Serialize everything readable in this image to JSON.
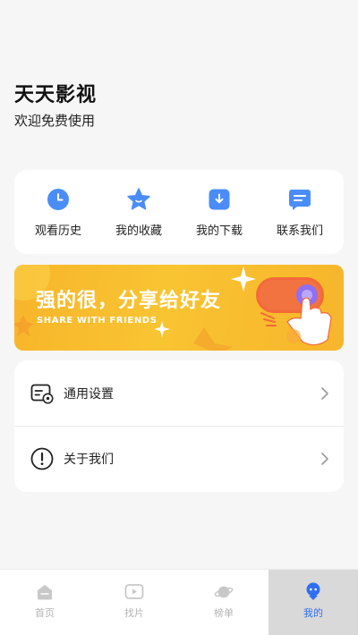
{
  "header": {
    "title": "天天影视",
    "subtitle": "欢迎免费使用"
  },
  "quick_actions": [
    {
      "label": "观看历史",
      "icon": "clock-icon"
    },
    {
      "label": "我的收藏",
      "icon": "star-icon"
    },
    {
      "label": "我的下载",
      "icon": "download-icon"
    },
    {
      "label": "联系我们",
      "icon": "chat-icon"
    }
  ],
  "banner": {
    "title": "强的很，分享给好友",
    "subtitle": "SHARE WITH FRIENDS"
  },
  "settings": [
    {
      "label": "通用设置",
      "icon": "settings-card-icon"
    },
    {
      "label": "关于我们",
      "icon": "info-icon"
    }
  ],
  "tabbar": {
    "active_index": 3,
    "tabs": [
      {
        "label": "首页",
        "icon": "home-icon"
      },
      {
        "label": "找片",
        "icon": "play-icon"
      },
      {
        "label": "榜单",
        "icon": "planet-icon"
      },
      {
        "label": "我的",
        "icon": "profile-icon"
      }
    ]
  },
  "colors": {
    "accent_blue": "#2f6ff0",
    "icon_blue": "#4a8df8",
    "banner_yellow": "#f9c432",
    "banner_orange": "#f4683a",
    "tab_inactive": "#b4b4b4",
    "tab_active_bg": "#d9d9d9"
  }
}
